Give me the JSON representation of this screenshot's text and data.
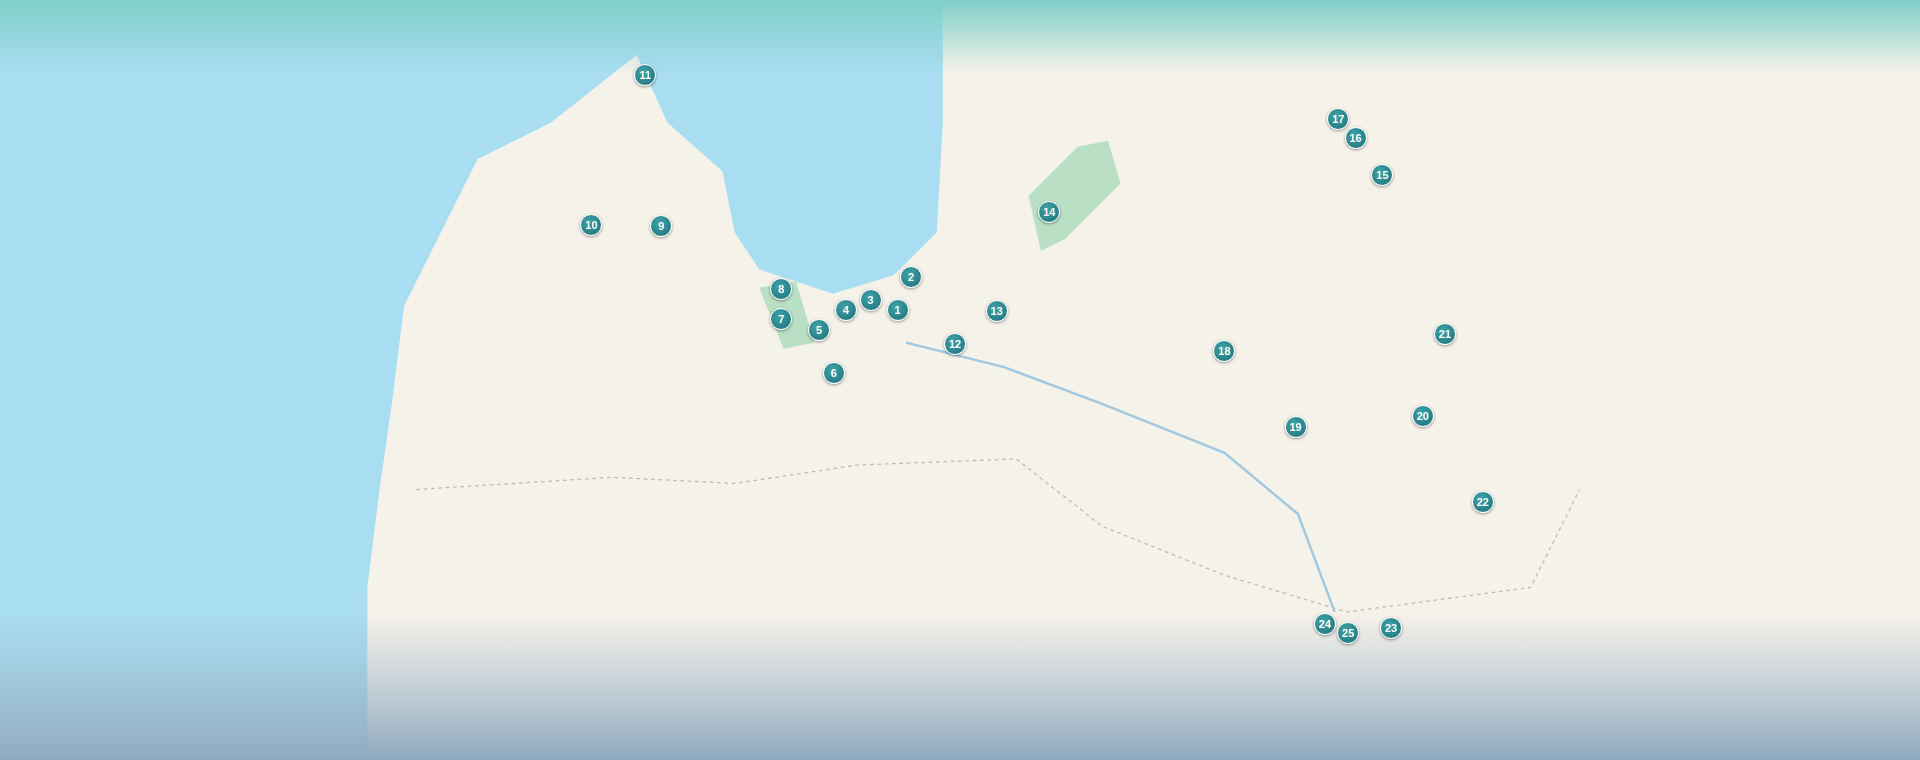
{
  "map": {
    "markers": [
      {
        "label": "1"
      },
      {
        "label": "2"
      },
      {
        "label": "3"
      },
      {
        "label": "4"
      },
      {
        "label": "5"
      },
      {
        "label": "6"
      },
      {
        "label": "7"
      },
      {
        "label": "8"
      },
      {
        "label": "9"
      },
      {
        "label": "10"
      },
      {
        "label": "11"
      },
      {
        "label": "12"
      },
      {
        "label": "13"
      },
      {
        "label": "14"
      },
      {
        "label": "15"
      },
      {
        "label": "16"
      },
      {
        "label": "17"
      },
      {
        "label": "18"
      },
      {
        "label": "19"
      },
      {
        "label": "20"
      },
      {
        "label": "21"
      },
      {
        "label": "22"
      },
      {
        "label": "23"
      },
      {
        "label": "24"
      },
      {
        "label": "25"
      }
    ]
  }
}
